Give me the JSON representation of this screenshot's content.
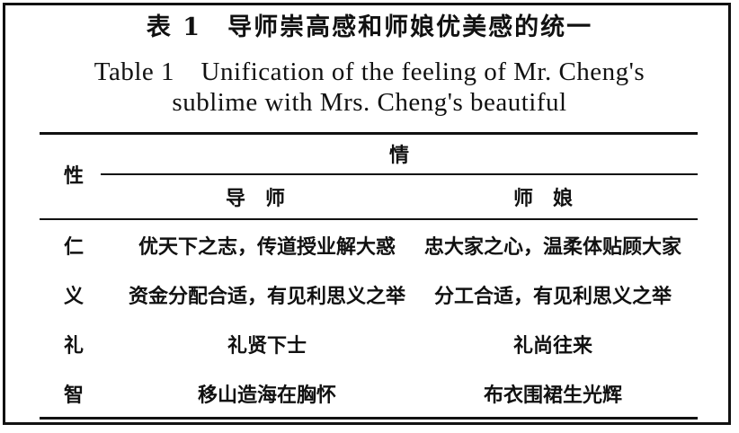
{
  "title": {
    "cn": "表 1　导师崇高感和师娘优美感的统一",
    "en_line1": "Table 1　Unification of the feeling of Mr. Cheng's",
    "en_line2": "sublime with Mrs. Cheng's beautiful"
  },
  "table": {
    "header": {
      "row_label": "性",
      "group_label": "情",
      "col_a": "导师",
      "col_b": "师娘"
    },
    "rows": [
      {
        "label": "仁",
        "a": "优天下之志，传道授业解大惑",
        "b": "忠大家之心，温柔体贴顾大家"
      },
      {
        "label": "义",
        "a": "资金分配合适，有见利思义之举",
        "b": "分工合适，有见利思义之举"
      },
      {
        "label": "礼",
        "a": "礼贤下士",
        "b": "礼尚往来"
      },
      {
        "label": "智",
        "a": "移山造海在胸怀",
        "b": "布衣围裙生光辉"
      }
    ]
  }
}
